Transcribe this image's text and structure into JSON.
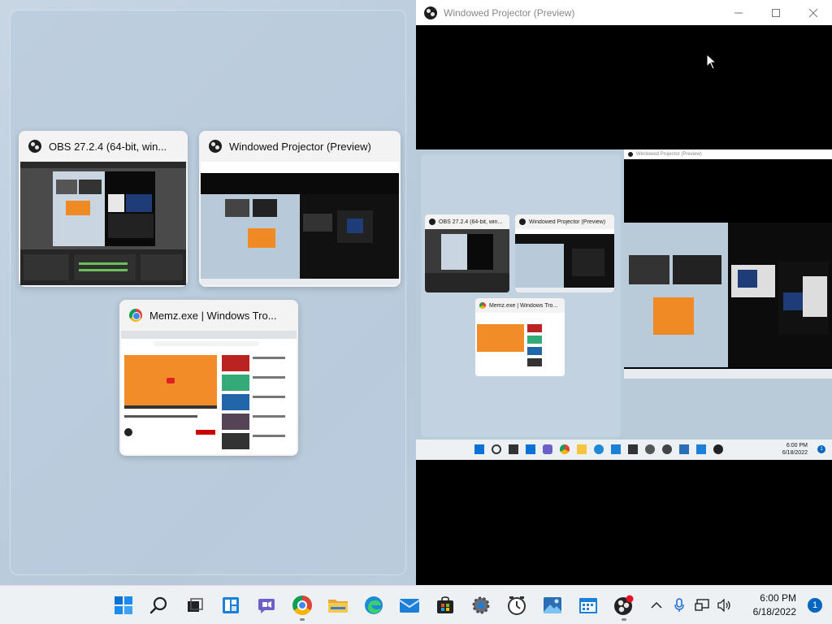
{
  "snap_assist": {
    "windows": [
      {
        "title": "OBS 27.2.4 (64-bit, win...",
        "icon": "obs-icon"
      },
      {
        "title": "Windowed Projector (Preview)",
        "icon": "obs-icon"
      },
      {
        "title": "Memz.exe | Windows Tro...",
        "icon": "chrome-icon"
      }
    ]
  },
  "projector_window": {
    "title": "Windowed Projector (Preview)",
    "controls": [
      "minimize-icon",
      "maximize-icon",
      "close-icon"
    ],
    "nested_preview": {
      "titlebar": "Windowed Projector (Preview)",
      "cards": [
        "OBS 27.2.4 (64-bit, win...",
        "Windowed Projector (Preview)",
        "Memz.exe | Windows Tro..."
      ],
      "clock_time": "6:00 PM",
      "clock_date": "6/18/2022",
      "notif_count": "1"
    }
  },
  "taskbar": {
    "apps": [
      {
        "name": "start-icon",
        "running": false
      },
      {
        "name": "search-icon",
        "running": false
      },
      {
        "name": "task-view-icon",
        "running": false
      },
      {
        "name": "widgets-icon",
        "running": false
      },
      {
        "name": "chat-icon",
        "running": false
      },
      {
        "name": "chrome-icon",
        "running": true
      },
      {
        "name": "file-explorer-icon",
        "running": false
      },
      {
        "name": "edge-icon",
        "running": false
      },
      {
        "name": "mail-icon",
        "running": false
      },
      {
        "name": "store-icon",
        "running": false
      },
      {
        "name": "settings-icon",
        "running": false
      },
      {
        "name": "clock-app-icon",
        "running": false
      },
      {
        "name": "photos-icon",
        "running": false
      },
      {
        "name": "calendar-icon",
        "running": false
      },
      {
        "name": "obs-icon",
        "running": true
      }
    ],
    "tray": {
      "icons": [
        "chevron-up-icon",
        "microphone-icon",
        "network-icon",
        "volume-icon"
      ],
      "time": "6:00 PM",
      "date": "6/18/2022",
      "notification_count": "1"
    }
  }
}
